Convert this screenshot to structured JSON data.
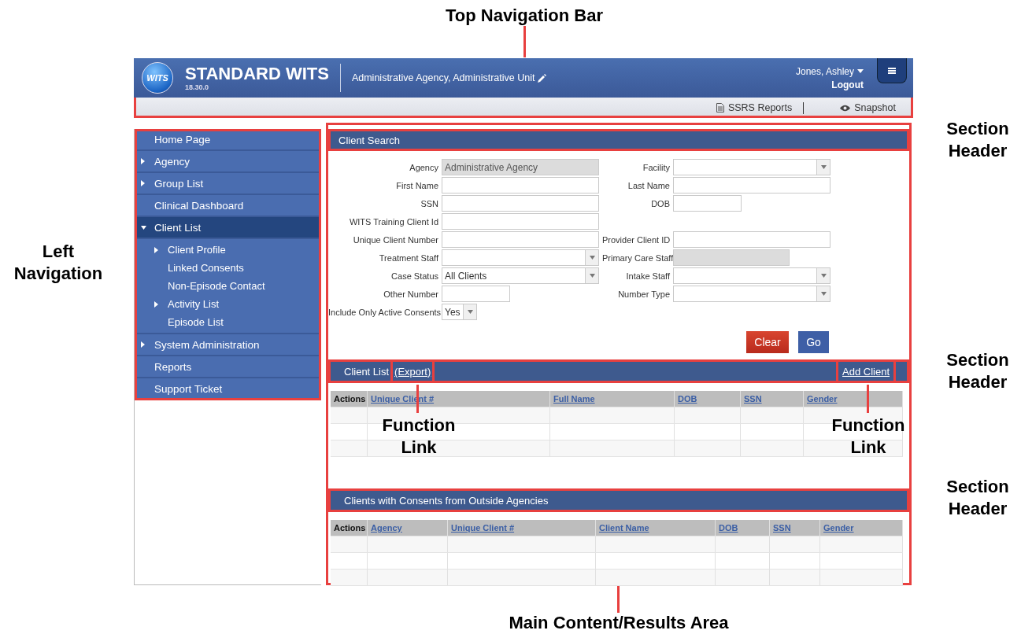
{
  "header": {
    "logo": "WITS",
    "title": "STANDARD WITS",
    "version": "18.30.0",
    "context": "Administrative Agency, Administrative Unit",
    "user": "Jones, Ashley",
    "logout": "Logout"
  },
  "toolbar": [
    {
      "kind": "report",
      "label": "SSRS Reports"
    },
    {
      "kind": "snapshot",
      "label": "Snapshot"
    }
  ],
  "sidebar": {
    "items": [
      {
        "label": "Home Page",
        "kind": "link",
        "selected": false
      },
      {
        "label": "Agency",
        "kind": "folder",
        "expanded": false,
        "selected": false
      },
      {
        "label": "Group List",
        "kind": "folder",
        "expanded": false,
        "selected": false
      },
      {
        "label": "Clinical Dashboard",
        "kind": "link",
        "selected": false
      },
      {
        "label": "Client List",
        "kind": "folder",
        "expanded": true,
        "selected": true,
        "children": [
          {
            "label": "Client Profile",
            "kind": "folder",
            "expanded": false
          },
          {
            "label": "Linked Consents",
            "kind": "link"
          },
          {
            "label": "Non-Episode Contact",
            "kind": "link"
          },
          {
            "label": "Activity List",
            "kind": "folder",
            "expanded": false
          },
          {
            "label": "Episode List",
            "kind": "link"
          }
        ]
      },
      {
        "label": "System Administration",
        "kind": "folder",
        "expanded": false,
        "selected": false
      },
      {
        "label": "Reports",
        "kind": "link",
        "selected": false
      },
      {
        "label": "Support Ticket",
        "kind": "link",
        "selected": false
      }
    ]
  },
  "client_search": {
    "title": "Client Search",
    "rows": [
      {
        "left": {
          "label": "Agency",
          "kind": "readonly",
          "value": "Administrative Agency"
        },
        "right": {
          "label": "Facility",
          "kind": "select"
        }
      },
      {
        "left": {
          "label": "First Name",
          "kind": "text"
        },
        "right": {
          "label": "Last Name",
          "kind": "text"
        }
      },
      {
        "left": {
          "label": "SSN",
          "kind": "text"
        },
        "right": {
          "label": "DOB",
          "kind": "short"
        }
      },
      {
        "left": {
          "label": "WITS Training Client Id",
          "kind": "text"
        }
      },
      {
        "left": {
          "label": "Unique Client Number",
          "kind": "text"
        },
        "right": {
          "label": "Provider Client ID",
          "kind": "text"
        }
      },
      {
        "left": {
          "label": "Treatment Staff",
          "kind": "select"
        },
        "right": {
          "label": "Primary Care Staff",
          "kind": "readonly-short"
        }
      },
      {
        "left": {
          "label": "Case Status",
          "kind": "select",
          "value": "All Clients"
        },
        "right": {
          "label": "Intake Staff",
          "kind": "select"
        }
      },
      {
        "left": {
          "label": "Other Number",
          "kind": "short"
        },
        "right": {
          "label": "Number Type",
          "kind": "select"
        }
      },
      {
        "left": {
          "label": "Include Only Active Consents",
          "kind": "mini-select",
          "value": "Yes"
        }
      }
    ],
    "buttons": [
      {
        "kind": "clear",
        "label": "Clear"
      },
      {
        "kind": "go",
        "label": "Go"
      }
    ]
  },
  "client_list": {
    "title": "Client List",
    "export": "(Export)",
    "add": "Add Client",
    "columns": [
      {
        "label": "Actions",
        "sortable": false
      },
      {
        "label": "Unique Client #",
        "sortable": true
      },
      {
        "label": "Full Name",
        "sortable": true
      },
      {
        "label": "DOB",
        "sortable": true
      },
      {
        "label": "SSN",
        "sortable": true
      },
      {
        "label": "Gender",
        "sortable": true
      }
    ]
  },
  "outside_consents": {
    "title": "Clients with Consents from Outside Agencies",
    "columns": [
      {
        "label": "Actions",
        "sortable": false
      },
      {
        "label": "Agency",
        "sortable": true
      },
      {
        "label": "Unique Client #",
        "sortable": true
      },
      {
        "label": "Client Name",
        "sortable": true
      },
      {
        "label": "DOB",
        "sortable": true
      },
      {
        "label": "SSN",
        "sortable": true
      },
      {
        "label": "Gender",
        "sortable": true
      }
    ]
  },
  "annotations": [
    {
      "kind": "top",
      "text": "Top Navigation Bar"
    },
    {
      "kind": "left",
      "text": "Left Navigation"
    },
    {
      "kind": "right",
      "text": "Section Header"
    },
    {
      "kind": "right",
      "text": "Section Header"
    },
    {
      "kind": "right",
      "text": "Section Header"
    },
    {
      "kind": "link",
      "text": "Function Link"
    },
    {
      "kind": "link",
      "text": "Function Link"
    },
    {
      "kind": "bottom",
      "text": "Main Content/Results Area"
    }
  ]
}
